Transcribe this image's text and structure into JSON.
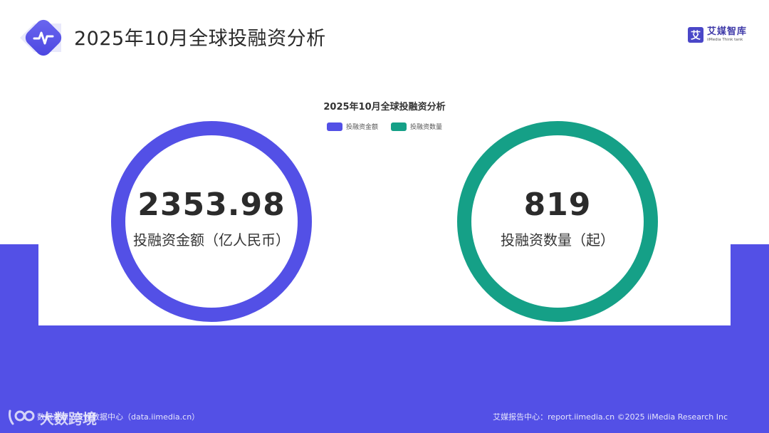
{
  "header": {
    "title": "2025年10月全球投融资分析",
    "icon": "pulse-icon"
  },
  "brand": {
    "name": "艾媒智库",
    "subtitle": "iiMedia Think tank",
    "mark": "艾"
  },
  "colors": {
    "primary": "#5350e6",
    "secondary": "#15a087"
  },
  "chart_data": {
    "type": "pie",
    "title": "2025年10月全球投融资分析",
    "legend_position": "top",
    "legend": [
      "投融资金额",
      "投融资数量"
    ],
    "series": [
      {
        "name": "投融资金额",
        "value": "2353.98",
        "label": "投融资金额（亿人民币）",
        "color": "#5350e6"
      },
      {
        "name": "投融资数量",
        "value": "819",
        "label": "投融资数量（起）",
        "color": "#15a087"
      }
    ]
  },
  "footer": {
    "left": "数据来源：艾媒数据中心（data.iimedia.cn）",
    "right": "艾媒报告中心：report.iimedia.cn  ©2025 iiMedia Research Inc"
  },
  "watermark": {
    "text": "大数跨境"
  }
}
